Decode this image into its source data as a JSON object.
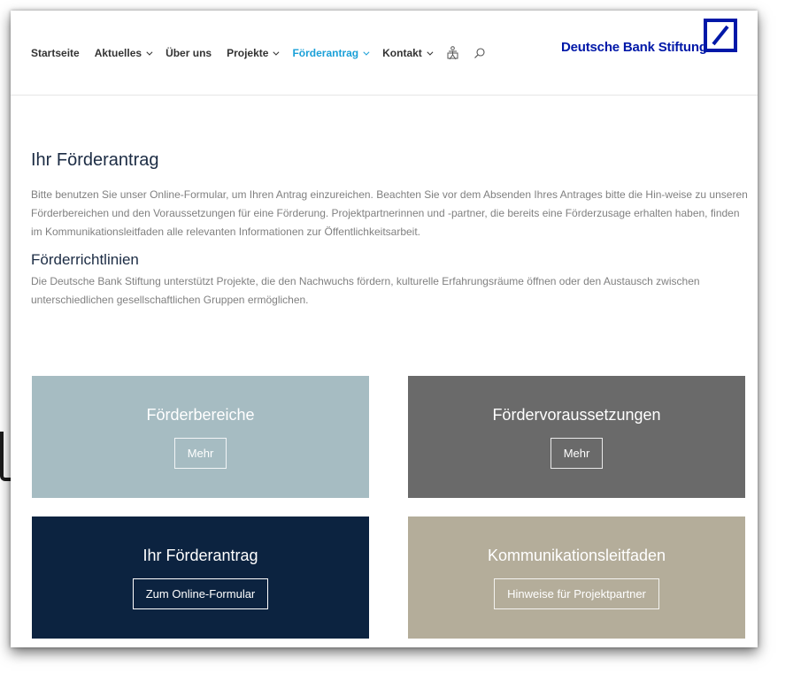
{
  "nav": {
    "items": [
      {
        "label": "Startseite",
        "has_dropdown": false,
        "active": false
      },
      {
        "label": "Aktuelles",
        "has_dropdown": true,
        "active": false
      },
      {
        "label": "Über uns",
        "has_dropdown": false,
        "active": false
      },
      {
        "label": "Projekte",
        "has_dropdown": true,
        "active": false
      },
      {
        "label": "Förderantrag",
        "has_dropdown": true,
        "active": true
      },
      {
        "label": "Kontakt",
        "has_dropdown": true,
        "active": false
      }
    ],
    "icons": [
      "accessibility-icon",
      "search-icon"
    ],
    "active_color": "#1aa0d8"
  },
  "brand": {
    "name": "Deutsche Bank Stiftung",
    "color": "#0018a8"
  },
  "main": {
    "title": "Ihr Förderantrag",
    "intro": "Bitte benutzen Sie unser Online-Formular, um Ihren Antrag einzureichen. Beachten Sie vor dem Absenden Ihres Antrages bitte die Hin-weise zu unseren Förderbereichen und den Voraussetzungen für eine Förderung. Projektpartnerinnen und -partner, die bereits eine Förderzusage erhalten haben, finden im Kommunikationsleitfaden alle relevanten Informationen zur Öffentlichkeitsarbeit.",
    "subtitle": "Förderrichtlinien",
    "guidelines": "Die Deutsche Bank Stiftung unterstützt Projekte, die den Nachwuchs fördern, kulturelle Erfahrungsräume öffnen oder den Austausch zwischen unterschiedlichen gesellschaftlichen Gruppen ermöglichen."
  },
  "tiles": [
    {
      "title": "Förderbereiche",
      "button": "Mehr",
      "bg": "#a6bcc2"
    },
    {
      "title": "Fördervoraussetzungen",
      "button": "Mehr",
      "bg": "#6a6a6a"
    },
    {
      "title": "Ihr Förderantrag",
      "button": "Zum Online-Formular",
      "bg": "#0c2340"
    },
    {
      "title": "Kommunikationsleitfaden",
      "button": "Hinweise für Projektpartner",
      "bg": "#b4ad9a"
    }
  ]
}
